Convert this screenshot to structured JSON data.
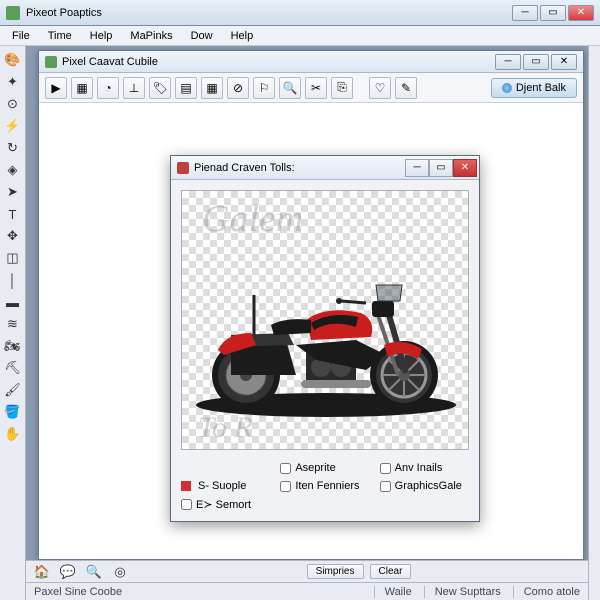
{
  "app": {
    "title": "Pixeot Poaptics"
  },
  "menu": [
    "File",
    "Time",
    "Help",
    "MaPinks",
    "Dow",
    "Help"
  ],
  "doc": {
    "title": "Pixel Caavat Cubile",
    "right_button": "Djent Balk"
  },
  "dialog": {
    "title": "Pienad Craven Tolls:",
    "options": {
      "c1r1": "Aseprite",
      "c2r1": "Anv Inails",
      "c3r1": "S- Suople",
      "c0r2": "Iten Fenniers",
      "c1r2": "GraphicsGale",
      "c2r2": "E≻ Semort"
    }
  },
  "bottom": {
    "b1": "Simpries",
    "b2": "Clear"
  },
  "status": {
    "left": "Paxel Sine Coobe",
    "r1": "Waile",
    "r2": "New Supttars",
    "r3": "Como atole"
  },
  "watermark": {
    "top": "Galem",
    "bot": "To R"
  }
}
